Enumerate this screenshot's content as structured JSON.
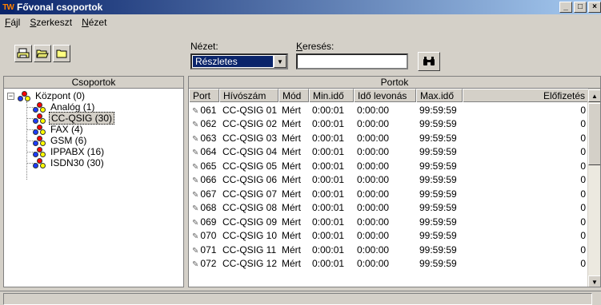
{
  "window": {
    "app_icon": "TW",
    "title": "Fővonal csoportok",
    "minimize_glyph": "_",
    "maximize_glyph": "□",
    "close_glyph": "×"
  },
  "menu": [
    {
      "key": "F",
      "rest": "ájl"
    },
    {
      "key": "S",
      "rest": "zerkeszt"
    },
    {
      "key": "N",
      "rest": "ézet"
    }
  ],
  "toolbar": {
    "icons": [
      "print-icon",
      "open-folder-icon",
      "folder-icon"
    ]
  },
  "view": {
    "label": "Nézet:",
    "selected": "Részletes"
  },
  "search": {
    "label_key": "K",
    "label_rest": "eresés:",
    "value": "",
    "button_icon": "binoculars-icon"
  },
  "groups_panel": {
    "header": "Csoportok",
    "root": {
      "label": "Központ (0)",
      "expander": "−"
    },
    "children": [
      {
        "label": "Analóg (1)",
        "selected": false
      },
      {
        "label": "CC-QSIG (30)",
        "selected": true
      },
      {
        "label": "FAX (4)",
        "selected": false
      },
      {
        "label": "GSM (6)",
        "selected": false
      },
      {
        "label": "IPPABX (16)",
        "selected": false
      },
      {
        "label": "ISDN30 (30)",
        "selected": false
      }
    ]
  },
  "ports_panel": {
    "header": "Portok",
    "columns": [
      "Port",
      "Hívószám",
      "Mód",
      "Min.idő",
      "Idő levonás",
      "Max.idő",
      "Előfizetés"
    ],
    "rows": [
      [
        "061",
        "CC-QSIG 01",
        "Mért",
        "0:00:01",
        "0:00:00",
        "99:59:59",
        "0"
      ],
      [
        "062",
        "CC-QSIG 02",
        "Mért",
        "0:00:01",
        "0:00:00",
        "99:59:59",
        "0"
      ],
      [
        "063",
        "CC-QSIG 03",
        "Mért",
        "0:00:01",
        "0:00:00",
        "99:59:59",
        "0"
      ],
      [
        "064",
        "CC-QSIG 04",
        "Mért",
        "0:00:01",
        "0:00:00",
        "99:59:59",
        "0"
      ],
      [
        "065",
        "CC-QSIG 05",
        "Mért",
        "0:00:01",
        "0:00:00",
        "99:59:59",
        "0"
      ],
      [
        "066",
        "CC-QSIG 06",
        "Mért",
        "0:00:01",
        "0:00:00",
        "99:59:59",
        "0"
      ],
      [
        "067",
        "CC-QSIG 07",
        "Mért",
        "0:00:01",
        "0:00:00",
        "99:59:59",
        "0"
      ],
      [
        "068",
        "CC-QSIG 08",
        "Mért",
        "0:00:01",
        "0:00:00",
        "99:59:59",
        "0"
      ],
      [
        "069",
        "CC-QSIG 09",
        "Mért",
        "0:00:01",
        "0:00:00",
        "99:59:59",
        "0"
      ],
      [
        "070",
        "CC-QSIG 10",
        "Mért",
        "0:00:01",
        "0:00:00",
        "99:59:59",
        "0"
      ],
      [
        "071",
        "CC-QSIG 11",
        "Mért",
        "0:00:01",
        "0:00:00",
        "99:59:59",
        "0"
      ],
      [
        "072",
        "CC-QSIG 12",
        "Mért",
        "0:00:01",
        "0:00:00",
        "99:59:59",
        "0"
      ]
    ]
  },
  "status": {
    "text": ""
  }
}
